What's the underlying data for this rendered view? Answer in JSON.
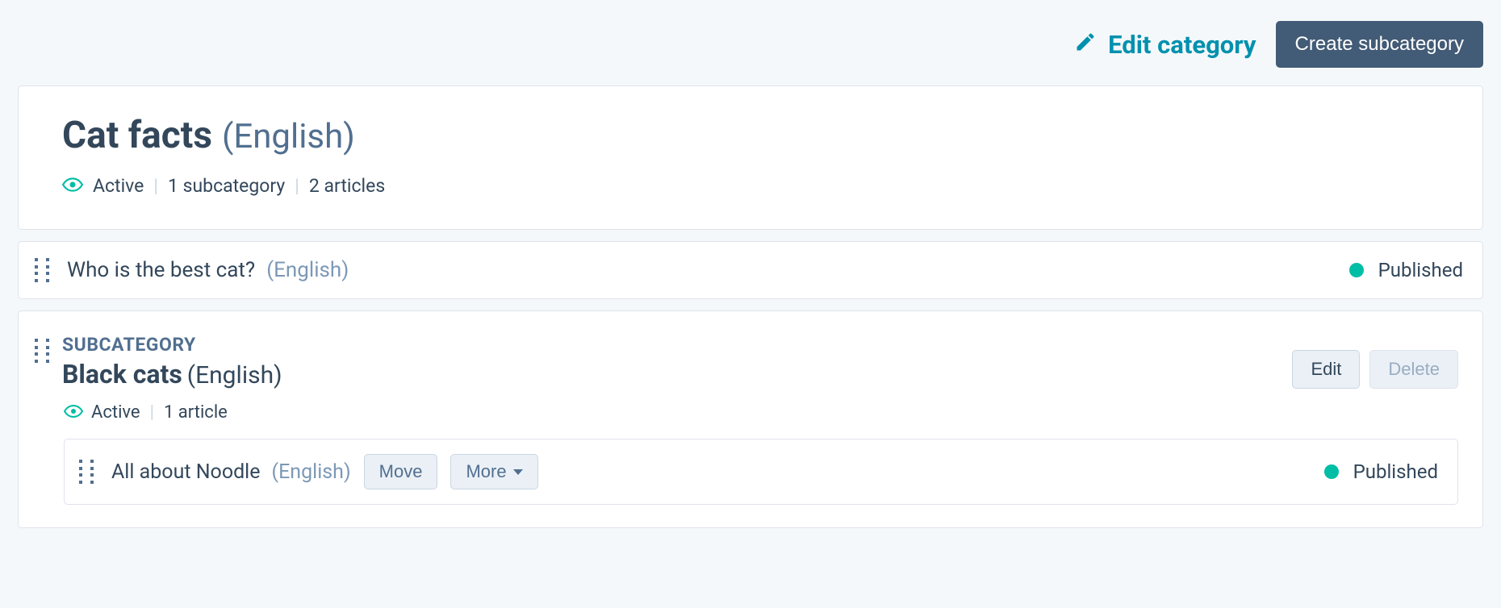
{
  "header": {
    "edit_category_label": "Edit category",
    "create_subcategory_label": "Create subcategory"
  },
  "category": {
    "title": "Cat facts",
    "language": "(English)",
    "status": "Active",
    "subcategories_text": "1 subcategory",
    "articles_text": "2 articles"
  },
  "articles": [
    {
      "title": "Who is the best cat?",
      "language": "(English)",
      "status_label": "Published"
    }
  ],
  "subcategory": {
    "label": "SUBCATEGORY",
    "name": "Black cats",
    "language": "(English)",
    "edit_label": "Edit",
    "delete_label": "Delete",
    "status": "Active",
    "articles_text": "1 article",
    "articles": [
      {
        "title": "All about Noodle",
        "language": "(English)",
        "move_label": "Move",
        "more_label": "More",
        "status_label": "Published"
      }
    ]
  }
}
